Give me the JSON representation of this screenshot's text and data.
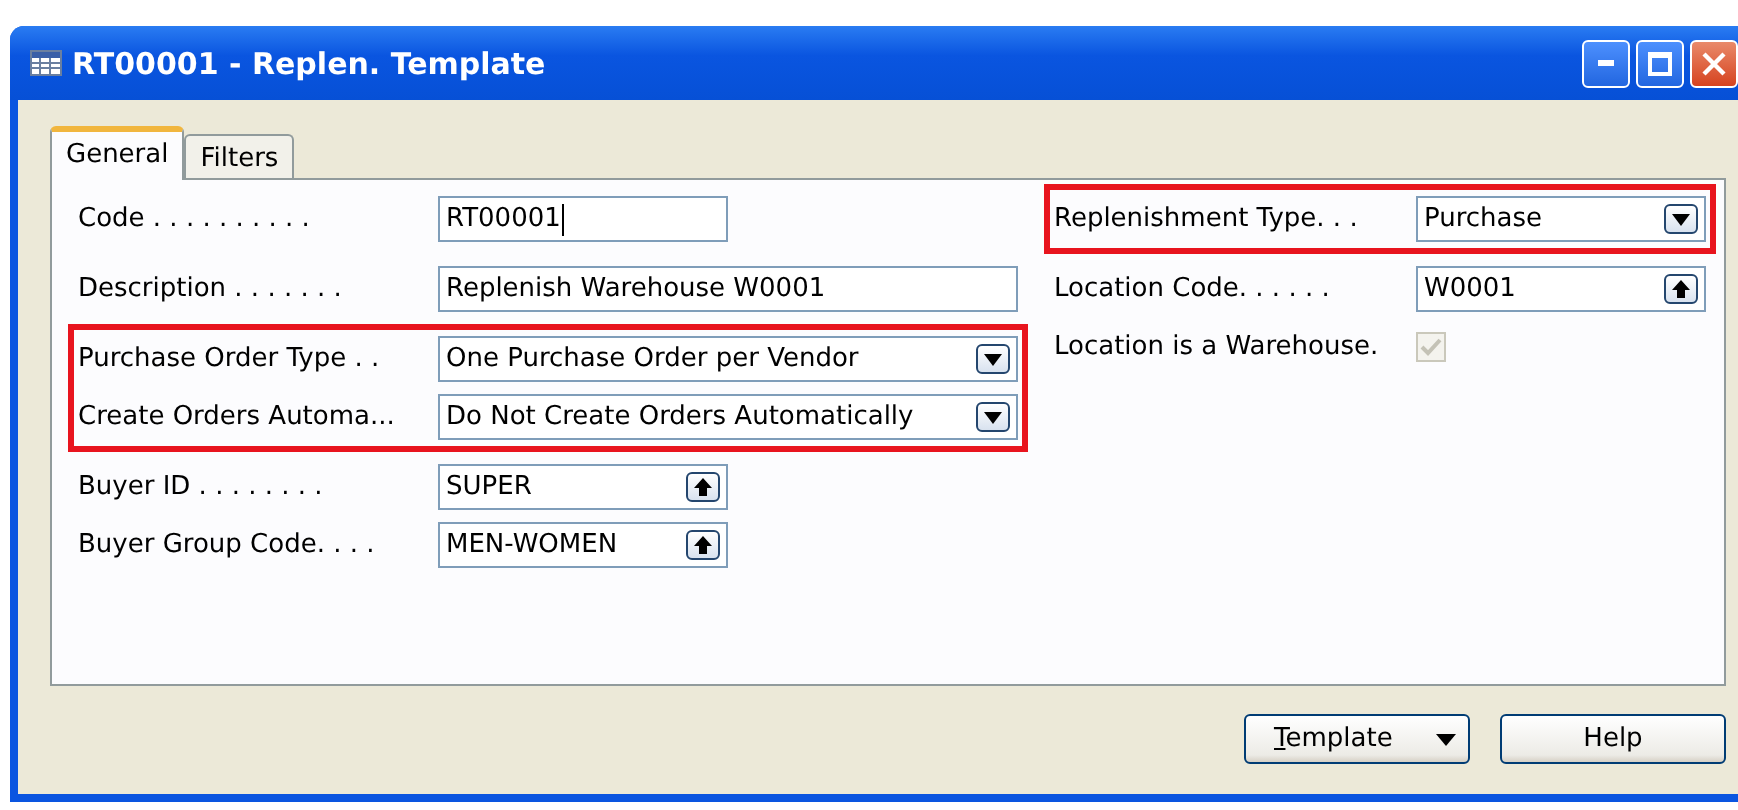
{
  "window": {
    "title": "RT00001 - Replen. Template"
  },
  "tabs": [
    {
      "label": "General",
      "selected": true
    },
    {
      "label": "Filters",
      "selected": false
    }
  ],
  "left_column": [
    {
      "fields": [
        {
          "label": "Code . . . . . . . . . .",
          "kind": "text",
          "value": "RT00001",
          "focused": true
        },
        {
          "label": "Description . . . . . . .",
          "kind": "text",
          "wide": true,
          "value": "Replenish Warehouse W0001"
        }
      ]
    },
    {
      "highlighted": true,
      "fields": [
        {
          "label": "Purchase Order Type . .",
          "kind": "option",
          "wide": true,
          "value": "One Purchase Order per Vendor"
        },
        {
          "label": "Create Orders Automa...",
          "kind": "option",
          "wide": true,
          "value": "Do Not Create Orders Automatically"
        }
      ]
    },
    {
      "fields": [
        {
          "label": "Buyer ID . . . . . . . .",
          "kind": "lookup",
          "value": "SUPER"
        },
        {
          "label": "Buyer Group Code. . . .",
          "kind": "lookup",
          "value": "MEN-WOMEN"
        }
      ]
    }
  ],
  "right_column": [
    {
      "highlighted": true,
      "fields": [
        {
          "label": "Replenishment Type. . .",
          "kind": "option",
          "value": "Purchase"
        }
      ]
    },
    {
      "fields": [
        {
          "label": "Location Code. . . . . .",
          "kind": "lookup",
          "value": "W0001"
        },
        {
          "label": "Location is a Warehouse.",
          "kind": "checkbox",
          "checked": true,
          "disabled": true
        }
      ]
    }
  ],
  "buttons": [
    {
      "label": "Template",
      "underline_first": true,
      "menu": true
    },
    {
      "label": "Help"
    }
  ]
}
